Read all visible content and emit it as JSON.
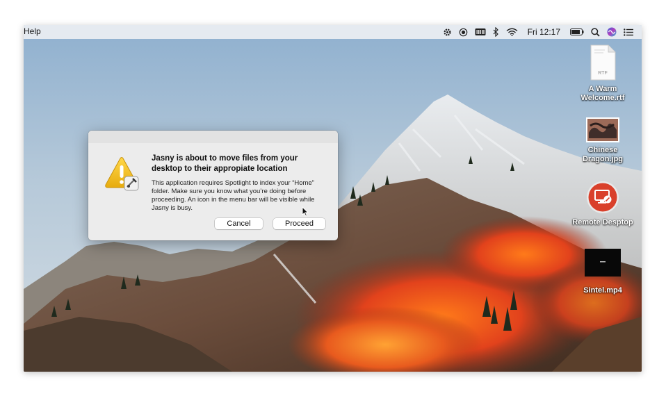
{
  "menubar": {
    "app_menu": "Help",
    "clock": "Fri 12:17",
    "icons": [
      "gear-icon",
      "record-icon",
      "keyboard-icon",
      "bluetooth-icon",
      "wifi-icon",
      "battery-icon",
      "spotlight-search-icon",
      "siri-icon",
      "notification-center-icon"
    ]
  },
  "dialog": {
    "title": "Jasny is about to move files from your desktop to their appropiate location",
    "message": "This application requires Spotlight to index your “Home” folder. Make sure you know what you’re doing before proceeding. An icon in the menu bar will be visible while Jasny is busy.",
    "cancel_label": "Cancel",
    "proceed_label": "Proceed",
    "icon": "warning-icon"
  },
  "desktop": {
    "items": [
      {
        "label": "A Warm Welcome.rtf",
        "icon": "rtf-file-icon",
        "badge": "RTF"
      },
      {
        "label": "Chinese Dragon.jpg",
        "icon": "image-thumbnail-icon"
      },
      {
        "label": "Remote Desptop",
        "icon": "remote-desktop-icon"
      },
      {
        "label": "Sintel.mp4",
        "icon": "video-thumbnail-icon"
      }
    ]
  },
  "colors": {
    "menubar_bg": "#eceef2",
    "dialog_bg": "#ececec",
    "remote_desktop_red": "#d9402b",
    "warning_yellow": "#f3c21b"
  }
}
